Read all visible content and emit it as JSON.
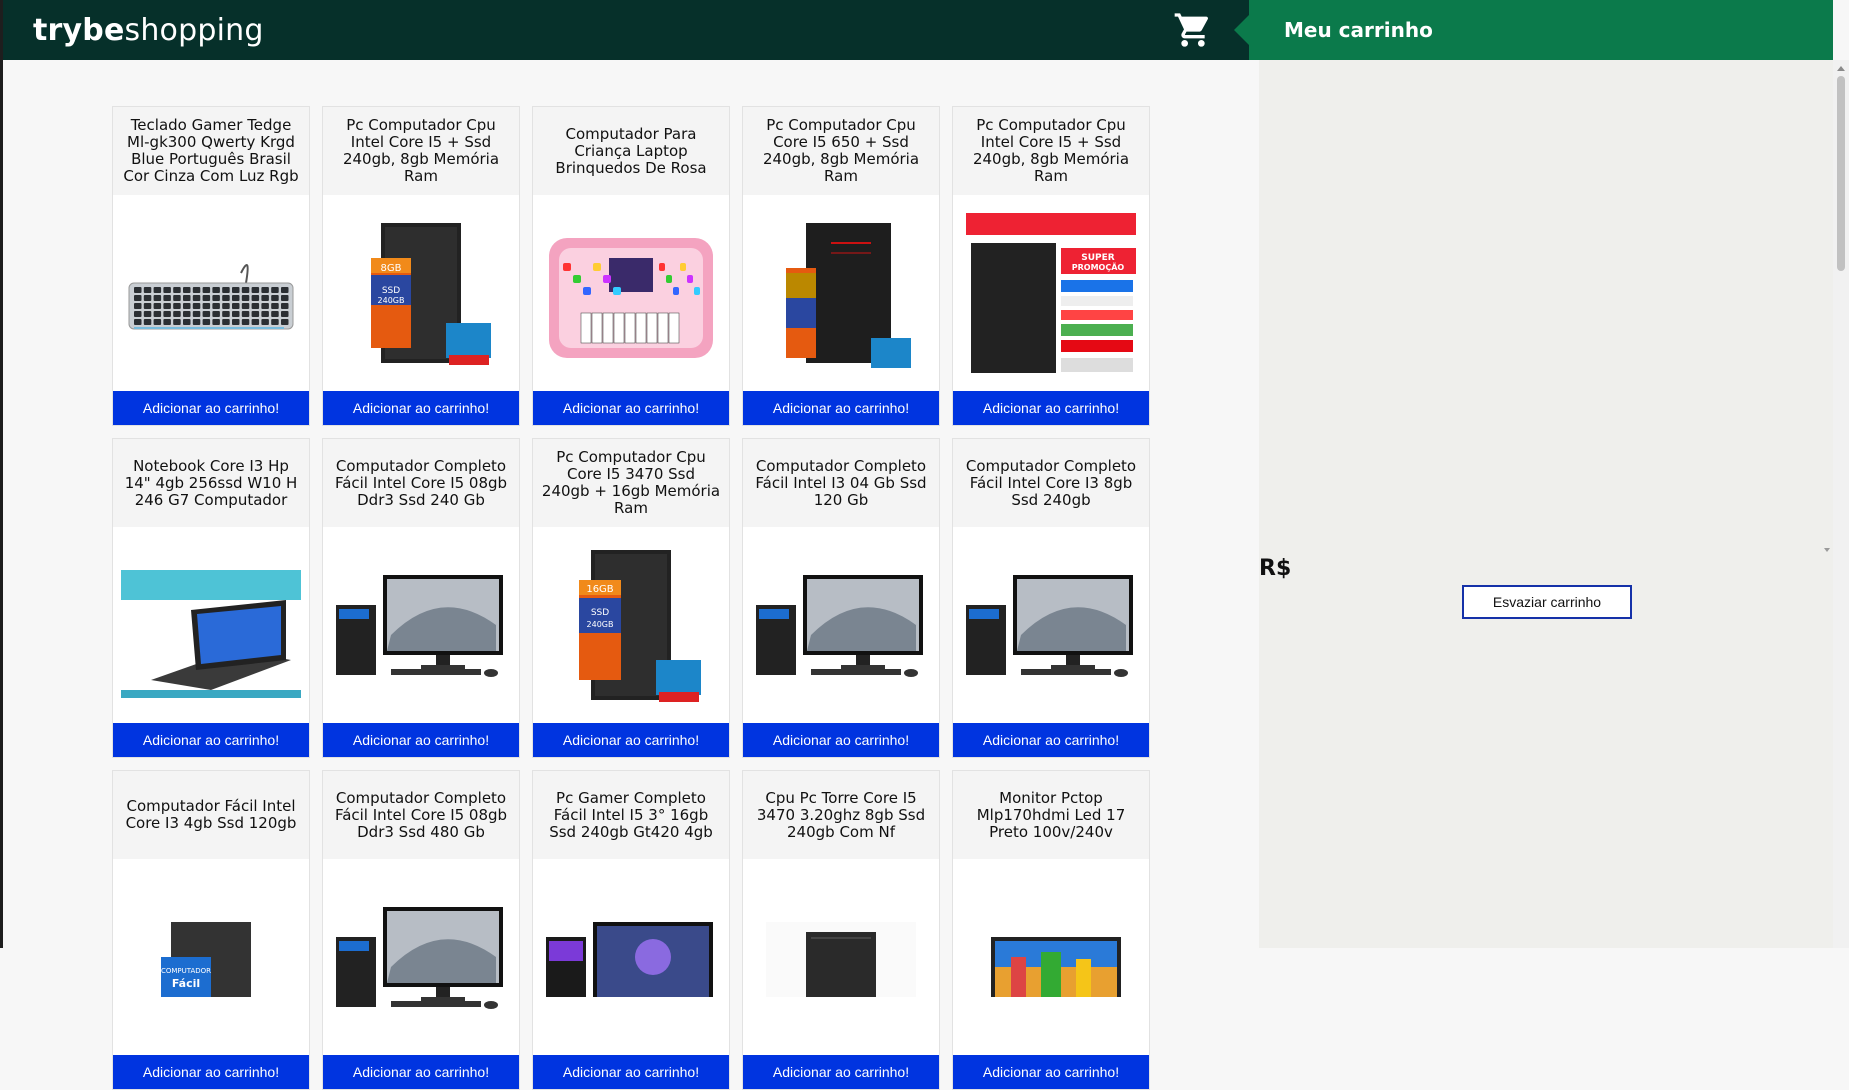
{
  "header": {
    "logo_bold": "trybe",
    "logo_light": "shopping"
  },
  "cart": {
    "title": "Meu carrinho",
    "total_label": "R$",
    "empty_button": "Esvaziar carrinho"
  },
  "colors": {
    "header_bg": "#06302a",
    "cart_head_bg": "#0b7a4b",
    "button_blue": "#0034e0"
  },
  "products": [
    {
      "title": "Teclado Gamer Tedge Ml-gk300 Qwerty Krgd Blue Português Brasil Cor Cinza Com Luz Rgb",
      "image": "keyboard",
      "button": "Adicionar ao carrinho!"
    },
    {
      "title": "Pc Computador Cpu Intel Core I5 + Ssd 240gb, 8gb Memória Ram",
      "image": "tower-8gb",
      "button": "Adicionar ao carrinho!"
    },
    {
      "title": "Computador Para Criança Laptop Brinquedos De Rosa",
      "image": "toy-laptop",
      "button": "Adicionar ao carrinho!"
    },
    {
      "title": "Pc Computador Cpu Core I5 650 + Ssd 240gb, 8gb Memória Ram",
      "image": "tower-red",
      "button": "Adicionar ao carrinho!"
    },
    {
      "title": "Pc Computador Cpu Intel Core I5 + Ssd 240gb, 8gb Memória Ram",
      "image": "tower-promo",
      "button": "Adicionar ao carrinho!"
    },
    {
      "title": "Notebook Core I3 Hp 14\" 4gb 256ssd W10 H 246 G7 Computador",
      "image": "notebook",
      "button": "Adicionar ao carrinho!"
    },
    {
      "title": "Computador Completo Fácil Intel Core I5 08gb Ddr3 Ssd 240 Gb",
      "image": "desktop-set",
      "button": "Adicionar ao carrinho!"
    },
    {
      "title": "Pc Computador Cpu Core I5 3470 Ssd 240gb + 16gb Memória Ram",
      "image": "tower-16gb",
      "button": "Adicionar ao carrinho!"
    },
    {
      "title": "Computador Completo Fácil Intel I3 04 Gb Ssd 120 Gb",
      "image": "desktop-set",
      "button": "Adicionar ao carrinho!"
    },
    {
      "title": "Computador Completo Fácil Intel Core I3 8gb Ssd 240gb",
      "image": "desktop-set",
      "button": "Adicionar ao carrinho!"
    },
    {
      "title": "Computador Fácil Intel Core I3 4gb Ssd 120gb",
      "image": "tower-facil",
      "button": "Adicionar ao carrinho!"
    },
    {
      "title": "Computador Completo Fácil Intel Core I5 08gb Ddr3 Ssd 480 Gb",
      "image": "desktop-set",
      "button": "Adicionar ao carrinho!"
    },
    {
      "title": "Pc Gamer Completo Fácil Intel I5 3° 16gb Ssd 240gb Gt420 4gb",
      "image": "gamer-set",
      "button": "Adicionar ao carrinho!"
    },
    {
      "title": "Cpu Pc Torre Core I5 3470 3.20ghz 8gb Ssd 240gb Com Nf",
      "image": "tower-plain",
      "button": "Adicionar ao carrinho!"
    },
    {
      "title": "Monitor Pctop Mlp170hdmi Led 17 Preto 100v/240v",
      "image": "monitor",
      "button": "Adicionar ao carrinho!"
    }
  ]
}
